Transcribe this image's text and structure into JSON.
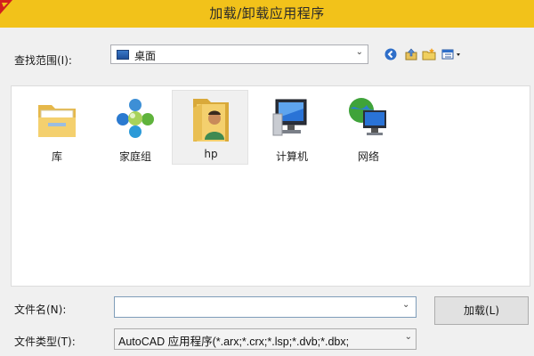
{
  "window": {
    "title": "加载/卸载应用程序",
    "accent_color": "#f2c21a"
  },
  "lookin": {
    "label": "查找范围(I):",
    "value": "桌面",
    "value_icon": "desktop-icon"
  },
  "toolbar": {
    "buttons": [
      "back-icon",
      "up-folder-icon",
      "new-folder-icon",
      "views-menu-icon"
    ]
  },
  "files": [
    {
      "label": "库",
      "icon": "library-folder-icon"
    },
    {
      "label": "家庭组",
      "icon": "homegroup-icon"
    },
    {
      "label": "hp",
      "icon": "user-folder-icon",
      "selected": true
    },
    {
      "label": "计算机",
      "icon": "computer-icon"
    },
    {
      "label": "网络",
      "icon": "network-icon"
    }
  ],
  "filename": {
    "label": "文件名(N):",
    "value": ""
  },
  "filetype": {
    "label": "文件类型(T):",
    "value": "AutoCAD 应用程序(*.arx;*.crx;*.lsp;*.dvb;*.dbx;"
  },
  "buttons": {
    "load_label": "加载(L)"
  }
}
